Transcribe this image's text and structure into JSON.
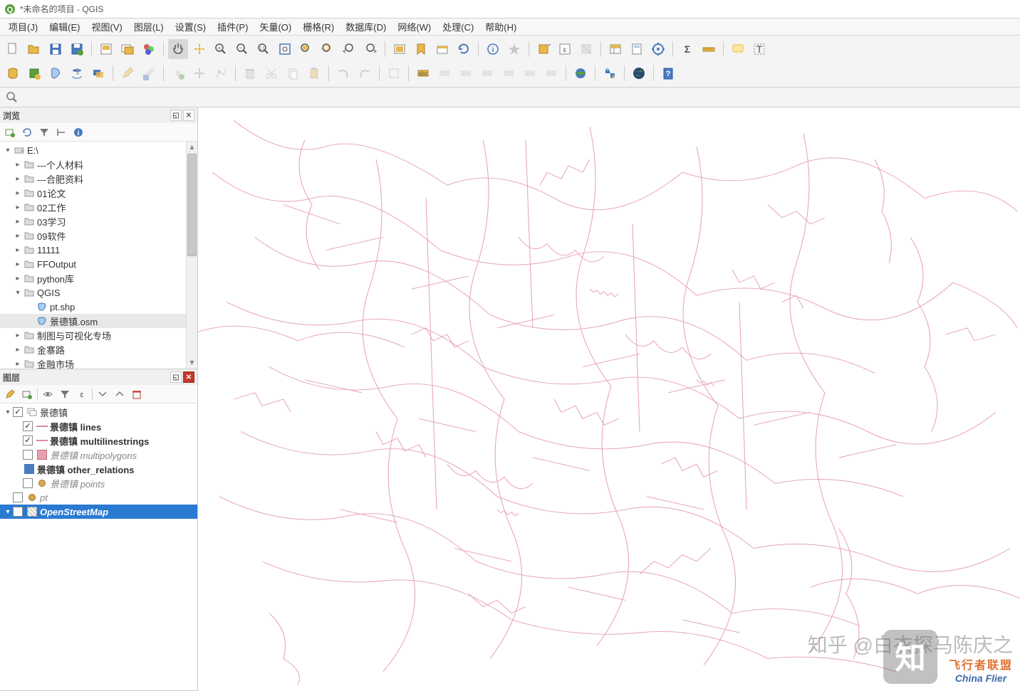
{
  "title": "*未命名的项目 - QGIS",
  "menu": [
    "项目(J)",
    "编辑(E)",
    "视图(V)",
    "图层(L)",
    "设置(S)",
    "插件(P)",
    "矢量(O)",
    "栅格(R)",
    "数据库(D)",
    "网络(W)",
    "处理(C)",
    "帮助(H)"
  ],
  "panels": {
    "browser": {
      "title": "浏览"
    },
    "layers": {
      "title": "图层"
    }
  },
  "browser_tree": [
    {
      "label": "E:\\",
      "icon": "drive",
      "depth": 0,
      "expanded": true,
      "arrow": "down"
    },
    {
      "label": "---个人材料",
      "icon": "folder",
      "depth": 1,
      "arrow": "right"
    },
    {
      "label": "---合肥资料",
      "icon": "folder",
      "depth": 1,
      "arrow": "right"
    },
    {
      "label": "01论文",
      "icon": "folder",
      "depth": 1,
      "arrow": "right"
    },
    {
      "label": "02工作",
      "icon": "folder",
      "depth": 1,
      "arrow": "right"
    },
    {
      "label": "03学习",
      "icon": "folder",
      "depth": 1,
      "arrow": "right"
    },
    {
      "label": "09软件",
      "icon": "folder",
      "depth": 1,
      "arrow": "right"
    },
    {
      "label": "11111",
      "icon": "folder",
      "depth": 1,
      "arrow": "right"
    },
    {
      "label": "FFOutput",
      "icon": "folder",
      "depth": 1,
      "arrow": "right"
    },
    {
      "label": "python库",
      "icon": "folder",
      "depth": 1,
      "arrow": "right"
    },
    {
      "label": "QGIS",
      "icon": "folder",
      "depth": 1,
      "expanded": true,
      "arrow": "down"
    },
    {
      "label": "pt.shp",
      "icon": "vector",
      "depth": 2
    },
    {
      "label": "景德镇.osm",
      "icon": "vector",
      "depth": 2,
      "selected": true
    },
    {
      "label": "制图与可视化专场",
      "icon": "folder",
      "depth": 1,
      "arrow": "right"
    },
    {
      "label": "金寨路",
      "icon": "folder",
      "depth": 1,
      "arrow": "right"
    },
    {
      "label": "金融市场",
      "icon": "folder",
      "depth": 1,
      "arrow": "right"
    }
  ],
  "layers_tree": [
    {
      "label": "景德镇",
      "icon": "group",
      "depth": 0,
      "arrow": "down",
      "checked": true
    },
    {
      "label": "景德镇 lines",
      "sym": "line",
      "depth": 1,
      "checked": true,
      "bold": true
    },
    {
      "label": "景德镇 multilinestrings",
      "sym": "line",
      "depth": 1,
      "checked": true,
      "bold": true
    },
    {
      "label": "景德镇 multipolygons",
      "sym": "poly",
      "depth": 1,
      "checked": false,
      "italic": true
    },
    {
      "label": "景德镇 other_relations",
      "sym": "oth",
      "depth": 1,
      "checked": null,
      "icon": "other",
      "bold": true
    },
    {
      "label": "景德镇 points",
      "sym": "pt",
      "depth": 1,
      "checked": false,
      "italic": true
    },
    {
      "label": "pt",
      "sym": "pt2",
      "depth": 0,
      "checked": false,
      "italic": true
    },
    {
      "label": "OpenStreetMap",
      "sym": "grid",
      "depth": 0,
      "checked": false,
      "hl": true,
      "arrow": "down",
      "italic": true,
      "bold": true
    }
  ],
  "watermark": {
    "zhihu": "知乎 @白衣探马陈庆之",
    "flier_cn": "飞行者联盟",
    "flier_en": "China Flier"
  }
}
